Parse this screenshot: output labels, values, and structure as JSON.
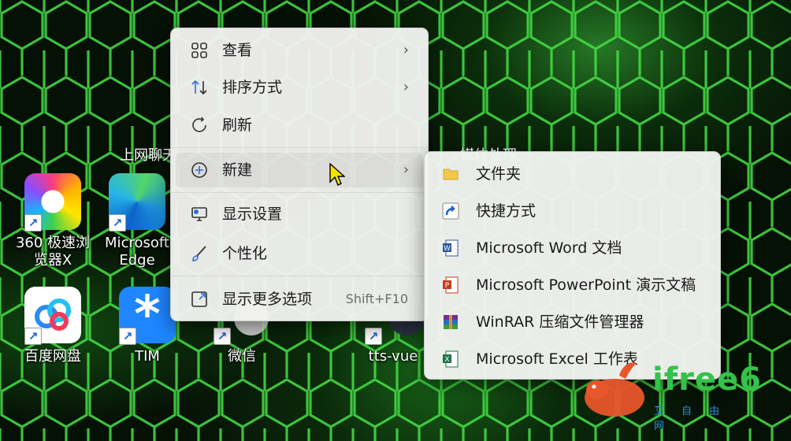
{
  "desktop": {
    "icons": [
      {
        "label": "360 极速浏览器X"
      },
      {
        "label": "Microsoft Edge"
      },
      {
        "label": "上网聊天"
      },
      {
        "label": "百度网盘"
      },
      {
        "label": "TIM"
      },
      {
        "label": "微信"
      },
      {
        "label": "tts-vue"
      },
      {
        "label": "媒体处理"
      }
    ],
    "shortcut_arrow": "↗"
  },
  "context_menu": {
    "items": [
      {
        "label": "查看",
        "icon": "grid-icon",
        "chevron": "›"
      },
      {
        "label": "排序方式",
        "icon": "sort-icon",
        "chevron": "›"
      },
      {
        "label": "刷新",
        "icon": "refresh-icon"
      },
      {
        "label": "新建",
        "icon": "new-plus-icon",
        "chevron": "›"
      },
      {
        "label": "显示设置",
        "icon": "display-icon"
      },
      {
        "label": "个性化",
        "icon": "brush-icon"
      },
      {
        "label": "显示更多选项",
        "icon": "more-options-icon",
        "shortcut": "Shift+F10"
      }
    ]
  },
  "submenu": {
    "items": [
      {
        "label": "文件夹",
        "icon": "folder-icon"
      },
      {
        "label": "快捷方式",
        "icon": "shortcut-icon"
      },
      {
        "label": "Microsoft Word 文档",
        "icon": "word-icon"
      },
      {
        "label": "Microsoft PowerPoint 演示文稿",
        "icon": "powerpoint-icon"
      },
      {
        "label": "WinRAR 压缩文件管理器",
        "icon": "winrar-icon"
      },
      {
        "label": "Microsoft Excel 工作表",
        "icon": "excel-icon"
      }
    ]
  },
  "watermark": {
    "brand": "ifree6",
    "sub": "艾自由网"
  },
  "colors": {
    "menu_bg": "#f1f3f0",
    "accent_green": "#33c24a",
    "hex_line": "#39d839"
  }
}
